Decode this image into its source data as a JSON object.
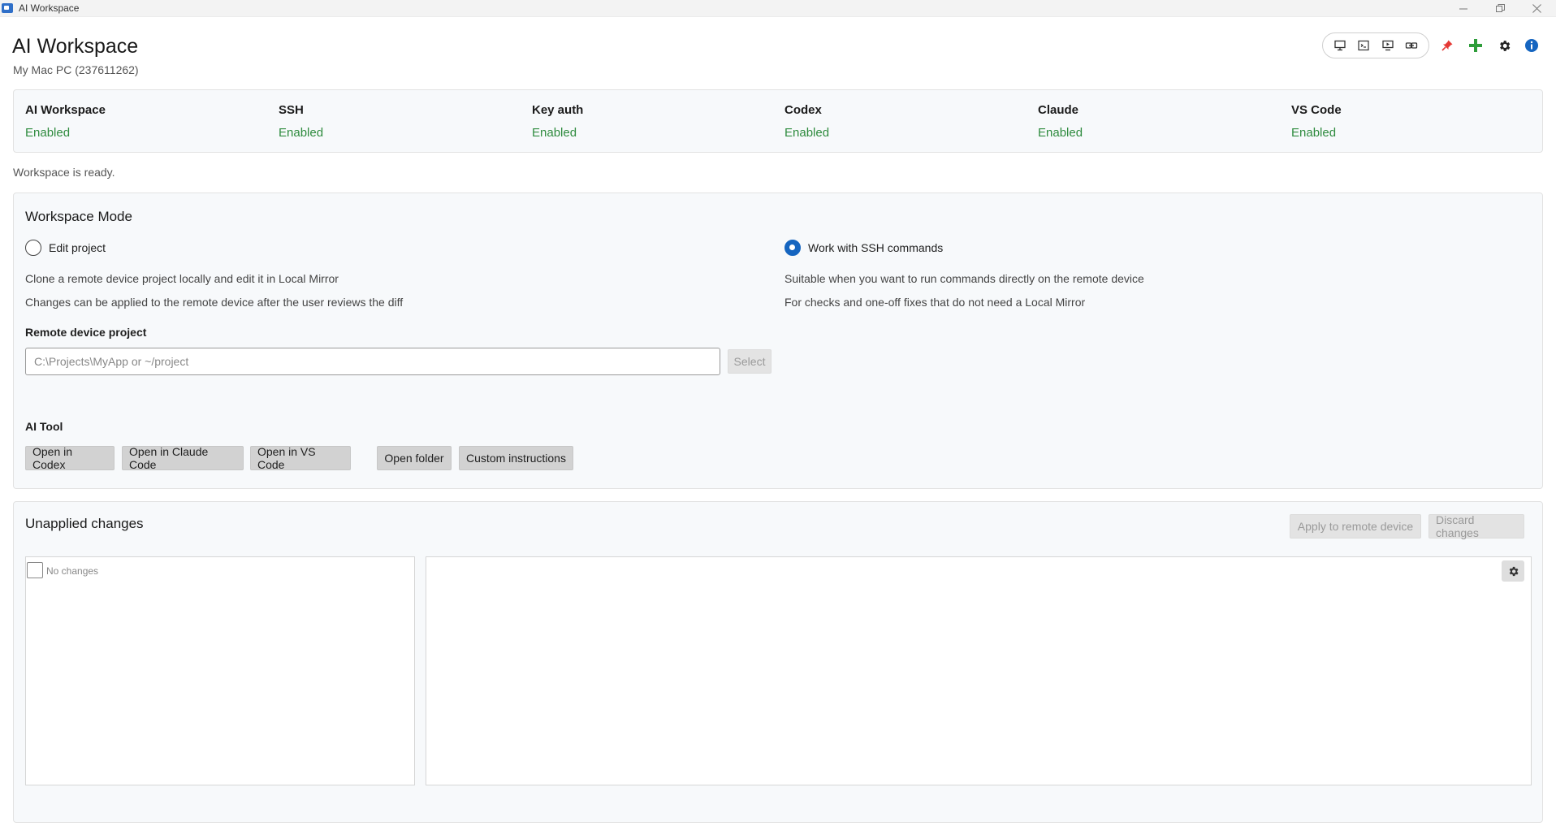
{
  "window": {
    "title": "AI Workspace",
    "controls": [
      "minimize-icon",
      "restore-icon",
      "close-icon"
    ]
  },
  "header": {
    "title": "AI Workspace",
    "subtitle": "My Mac PC (237611262)"
  },
  "toolbar": {
    "group_icons": [
      "monitor-icon",
      "terminal-icon",
      "remote-desktop-icon",
      "link-icon"
    ],
    "pin_icon": "pin-icon",
    "add_icon": "plus-icon",
    "settings_icon": "gear-icon",
    "info_icon": "info-icon",
    "colors": {
      "pin": "#e53935",
      "add": "#2e9d3a",
      "info": "#1565c0"
    }
  },
  "status": [
    {
      "label": "AI Workspace",
      "value": "Enabled"
    },
    {
      "label": "SSH",
      "value": "Enabled"
    },
    {
      "label": "Key auth",
      "value": "Enabled"
    },
    {
      "label": "Codex",
      "value": "Enabled"
    },
    {
      "label": "Claude",
      "value": "Enabled"
    },
    {
      "label": "VS Code",
      "value": "Enabled"
    }
  ],
  "status_color": "#2e8b3e",
  "ready_text": "Workspace is ready.",
  "mode": {
    "title": "Workspace Mode",
    "options": [
      {
        "label": "Edit project",
        "checked": false,
        "desc1": "Clone a remote device project locally and edit it in Local Mirror",
        "desc2": "Changes can be applied to the remote device after the user reviews the diff"
      },
      {
        "label": "Work with SSH commands",
        "checked": true,
        "desc1": "Suitable when you want to run commands directly on the remote device",
        "desc2": "For checks and one-off fixes that do not need a Local Mirror"
      }
    ],
    "project_label": "Remote device project",
    "project_placeholder": "C:\\Projects\\MyApp or ~/project",
    "select_label": "Select",
    "ai_tool_label": "AI Tool",
    "buttons": [
      "Open in Codex",
      "Open in Claude Code",
      "Open in VS Code",
      "Open folder",
      "Custom instructions"
    ]
  },
  "changes": {
    "title": "Unapplied changes",
    "apply_label": "Apply to remote device",
    "discard_label": "Discard changes",
    "empty_label": "No changes"
  }
}
